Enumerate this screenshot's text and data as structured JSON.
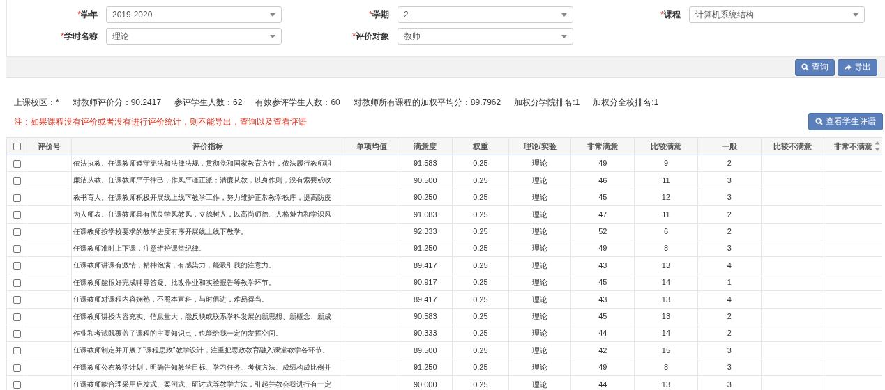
{
  "filters": [
    {
      "required_mark": "*",
      "label": "学年",
      "value": "2019-2020"
    },
    {
      "required_mark": "*",
      "label": "学期",
      "value": "2"
    },
    {
      "required_mark": "*",
      "label": "课程",
      "value": "计算机系统结构"
    },
    {
      "required_mark": "*",
      "label": "学时名称",
      "value": "理论"
    },
    {
      "required_mark": "*",
      "label": "评价对象",
      "value": "教师"
    }
  ],
  "toolbar_buttons": [
    {
      "kind": "search",
      "label": "查询"
    },
    {
      "kind": "export",
      "label": "导出"
    }
  ],
  "stats": [
    "上课校区：*",
    "对教师评价分：90.2417",
    "参评学生人数：62",
    "有效参评学生人数：60",
    "对教师所有课程的加权平均分：89.7962",
    "加权分学院排名:1",
    "加权分全校排名:1"
  ],
  "note": "注：如果课程没有评价或者没有进行评价统计，则不能导出，查询以及查看评语",
  "comments_button": {
    "kind": "search",
    "label": "查看学生评语"
  },
  "table": {
    "select_all_checked": false,
    "columns": [
      "评价号",
      "评价指标",
      "单项均值",
      "满意度",
      "权重",
      "理论/实验",
      "非常满意",
      "比较满意",
      "一般",
      "比较不满意",
      "非常不满意"
    ],
    "rows": [
      {
        "checked": false,
        "cells": [
          "",
          "依法执教。任课教师遵守宪法和法律法规，贯彻党和国家教育方针，依法履行教师职",
          "",
          "91.583",
          "0.25",
          "理论",
          "49",
          "9",
          "2",
          "",
          ""
        ]
      },
      {
        "checked": false,
        "cells": [
          "",
          "廉洁从教。任课教师严于律己，作风严谨正派；清廉从教，以身作则，没有索要或收",
          "",
          "90.500",
          "0.25",
          "理论",
          "46",
          "11",
          "3",
          "",
          ""
        ]
      },
      {
        "checked": false,
        "cells": [
          "",
          "教书育人。任课教师积极开展线上线下教学工作，努力维护正常教学秩序，提高防疫",
          "",
          "90.250",
          "0.25",
          "理论",
          "45",
          "12",
          "3",
          "",
          ""
        ]
      },
      {
        "checked": false,
        "cells": [
          "",
          "为人师表。任课教师具有优良学风教风，立德树人，以高尚师德、人格魅力和学识风",
          "",
          "91.083",
          "0.25",
          "理论",
          "47",
          "11",
          "2",
          "",
          ""
        ]
      },
      {
        "checked": false,
        "cells": [
          "",
          "任课教师按学校要求的教学进度有序开展线上线下教学。",
          "",
          "92.333",
          "0.25",
          "理论",
          "52",
          "6",
          "2",
          "",
          ""
        ]
      },
      {
        "checked": false,
        "cells": [
          "",
          "任课教师准时上下课，注意维护课堂纪律。",
          "",
          "91.250",
          "0.25",
          "理论",
          "49",
          "8",
          "3",
          "",
          ""
        ]
      },
      {
        "checked": false,
        "cells": [
          "",
          "任课教师讲课有激情，精神饱满，有感染力，能吸引我的注意力。",
          "",
          "89.417",
          "0.25",
          "理论",
          "43",
          "13",
          "4",
          "",
          ""
        ]
      },
      {
        "checked": false,
        "cells": [
          "",
          "任课教师能很好完成辅导答疑、批改作业和实验报告等教学环节。",
          "",
          "90.917",
          "0.25",
          "理论",
          "45",
          "14",
          "1",
          "",
          ""
        ]
      },
      {
        "checked": false,
        "cells": [
          "",
          "任课教师对课程内容娴熟，不照本宣科，与时俱进，难易得当。",
          "",
          "89.417",
          "0.25",
          "理论",
          "43",
          "13",
          "4",
          "",
          ""
        ]
      },
      {
        "checked": false,
        "cells": [
          "",
          "任课教师讲授内容充实、信息量大，能反映或联系学科发展的新思想、新概念、新成",
          "",
          "90.583",
          "0.25",
          "理论",
          "45",
          "13",
          "2",
          "",
          ""
        ]
      },
      {
        "checked": false,
        "cells": [
          "",
          "作业和考试既覆盖了课程的主要知识点，也能给我一定的发挥空间。",
          "",
          "90.333",
          "0.25",
          "理论",
          "44",
          "14",
          "2",
          "",
          ""
        ]
      },
      {
        "checked": false,
        "cells": [
          "",
          "任课教师制定并开展了“课程思政”教学设计，注重把思政教育融入课堂教学各环节。",
          "",
          "89.500",
          "0.25",
          "理论",
          "42",
          "15",
          "3",
          "",
          ""
        ]
      },
      {
        "checked": false,
        "cells": [
          "",
          "任课教师公布教学计划，明确告知教学目标、学习任务、考核方法、成绩构成比例并",
          "",
          "91.250",
          "0.25",
          "理论",
          "49",
          "8",
          "3",
          "",
          ""
        ]
      },
      {
        "checked": false,
        "cells": [
          "",
          "任课教师能合理采用启发式、案例式、研讨式等教学方法，引起并教会我进行有一定",
          "",
          "90.000",
          "0.25",
          "理论",
          "44",
          "13",
          "3",
          "",
          ""
        ]
      }
    ]
  }
}
